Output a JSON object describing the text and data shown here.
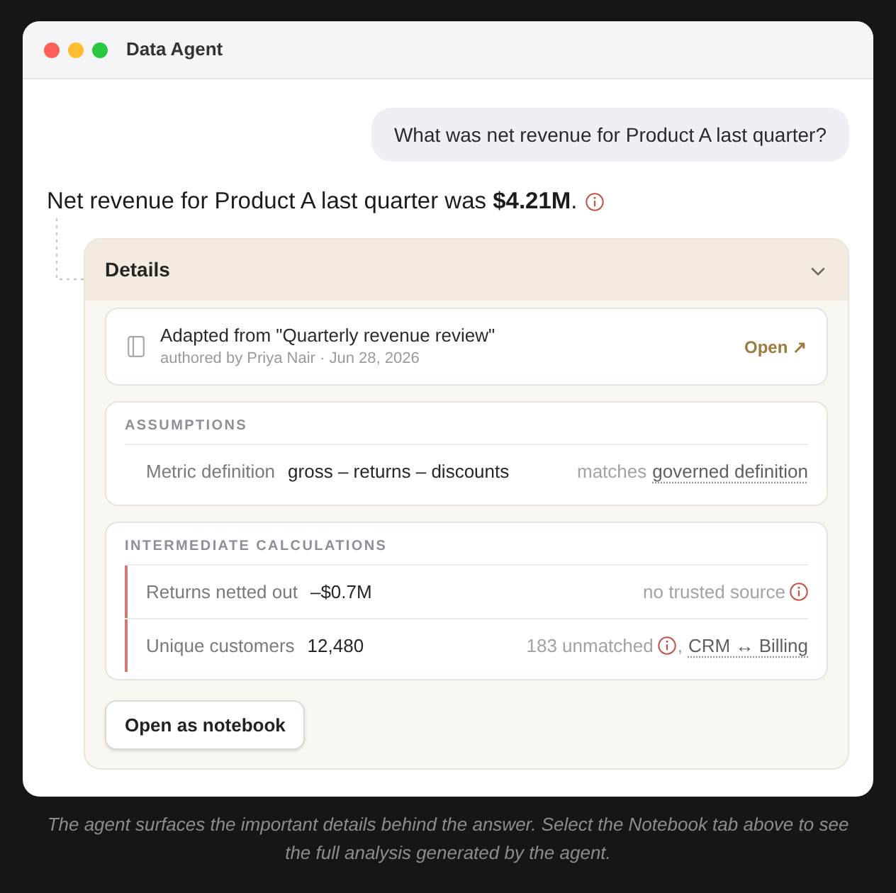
{
  "window": {
    "title": "Data Agent"
  },
  "user_message": {
    "text": "What was net revenue for Product A last quarter?"
  },
  "answer": {
    "text": "Net revenue for Product A last quarter was **$4.21M**.",
    "flagged": true
  },
  "details": {
    "title": "Details",
    "expanded": true,
    "source": {
      "title": "Adapted from \"Quarterly revenue review\"",
      "byline": "authored by Priya Nair · Jun 28, 2026",
      "link": "Open ↗"
    },
    "sections": [
      {
        "heading": "ASSUMPTIONS",
        "rows": [
          {
            "label": "Metric definition",
            "value": "gross – returns – discounts",
            "flagged": false,
            "note": [
              {
                "kind": "text",
                "text": "matches",
                "flagged": false
              },
              {
                "kind": "link",
                "text": "governed definition"
              }
            ]
          }
        ]
      },
      {
        "heading": "INTERMEDIATE CALCULATIONS",
        "rows": [
          {
            "label": "Returns netted out",
            "value": "–$0.7M",
            "flagged": true,
            "note": [
              {
                "kind": "text",
                "text": "no trusted source",
                "flagged": true
              }
            ]
          },
          {
            "label": "Unique customers",
            "value": "12,480",
            "flagged": true,
            "note": [
              {
                "kind": "text",
                "text": "183 unmatched",
                "flagged": true
              },
              {
                "kind": "punct",
                "text": ","
              },
              {
                "kind": "link",
                "text": "CRM ↔ Billing"
              }
            ]
          }
        ]
      }
    ],
    "button": "Open as notebook"
  },
  "caption": "The agent surfaces the important details behind the answer. Select the Notebook tab above to see the full analysis generated by the agent."
}
